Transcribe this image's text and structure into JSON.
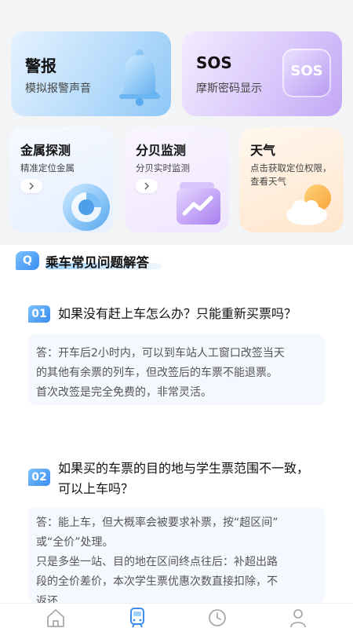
{
  "cards": {
    "alarm": {
      "title": "警报",
      "subtitle": "模拟报警声音",
      "icon": "bell-icon"
    },
    "sos": {
      "title": "SOS",
      "subtitle": "摩斯密码显示",
      "icon_text": "SOS"
    },
    "metal": {
      "title": "金属探测",
      "subtitle": "精准定位金属",
      "icon": "radar-icon"
    },
    "decibel": {
      "title": "分贝监测",
      "subtitle": "分贝实时监测",
      "icon": "chart-icon"
    },
    "weather": {
      "title": "天气",
      "subtitle_line1": "点击获取定位权限，",
      "subtitle_line2": "查看天气",
      "icon": "weather-icon"
    }
  },
  "faq": {
    "badge": "Q",
    "title": "乘车常见问题解答",
    "items": [
      {
        "num": "01",
        "question": "如果没有赶上车怎么办？只能重新买票吗？",
        "answer_lines": [
          "答：开车后2小时内，可以到车站人工窗口改签当天",
          "的其他有余票的列车，但改签后的车票不能退票。",
          "首次改签是完全免费的，非常灵活。"
        ]
      },
      {
        "num": "02",
        "question_lines": [
          "如果买的车票的目的地与学生票范围不一致，",
          "可以上车吗？"
        ],
        "answer_lines": [
          "答：能上车，但大概率会被要求补票，按“超区间”",
          "或“全价”处理。",
          "只是多坐一站、目的地在区间终点往后：补超出路",
          "段的全价差价，本次学生票优惠次数直接扣除，不",
          "返还"
        ]
      }
    ]
  },
  "nav": [
    "home-icon",
    "train-icon",
    "clock-icon",
    "user-icon"
  ],
  "colors": {
    "accent": "#3a8cf0",
    "nav_active": "#3a8cf0",
    "nav_inactive": "#aaaaaa"
  }
}
